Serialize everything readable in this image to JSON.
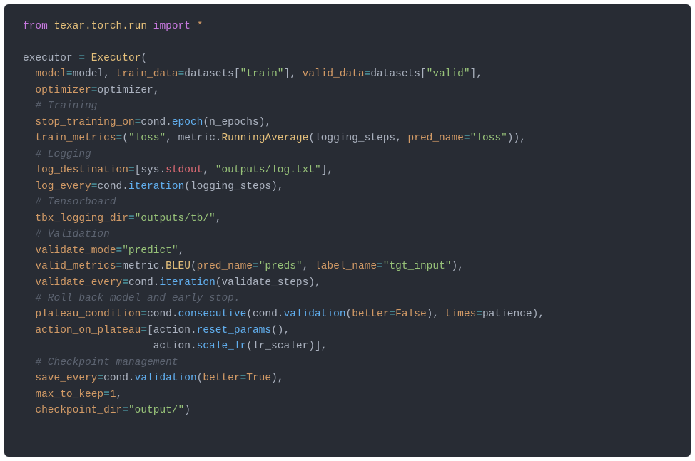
{
  "line1": {
    "from": "from",
    "mod": "texar.torch.run",
    "imp": "import",
    "star": "*"
  },
  "line3": {
    "lhs": "executor ",
    "eq": "= ",
    "cls": "Executor",
    "open": "("
  },
  "line4": {
    "i": "  ",
    "k1": "model",
    "eq": "=",
    "v1": "model, ",
    "k2": "train_data",
    "v2": "datasets[",
    "s2": "\"train\"",
    "c2": "], ",
    "k3": "valid_data",
    "v3": "datasets[",
    "s3": "\"valid\"",
    "c3": "],"
  },
  "line5": {
    "i": "  ",
    "k": "optimizer",
    "eq": "=",
    "v": "optimizer,"
  },
  "line6": {
    "i": "  ",
    "cmt": "# Training"
  },
  "line7": {
    "i": "  ",
    "k": "stop_training_on",
    "eq": "=",
    "obj": "cond.",
    "fn": "epoch",
    "open": "(",
    "arg": "n_epochs",
    "close": "),"
  },
  "line8": {
    "i": "  ",
    "k": "train_metrics",
    "eq": "=",
    "open": "(",
    "s": "\"loss\"",
    "comma": ", ",
    "obj": "metric.",
    "cls": "RunningAverage",
    "open2": "(",
    "arg1": "logging_steps, ",
    "k2": "pred_name",
    "eq2": "=",
    "s2": "\"loss\"",
    "close": ")),"
  },
  "line9": {
    "i": "  ",
    "cmt": "# Logging"
  },
  "line10": {
    "i": "  ",
    "k": "log_destination",
    "eq": "=",
    "open": "[",
    "obj": "sys.",
    "attr": "stdout",
    "comma": ", ",
    "s": "\"outputs/log.txt\"",
    "close": "],"
  },
  "line11": {
    "i": "  ",
    "k": "log_every",
    "eq": "=",
    "obj": "cond.",
    "fn": "iteration",
    "open": "(",
    "arg": "logging_steps",
    "close": "),"
  },
  "line12": {
    "i": "  ",
    "cmt": "# Tensorboard"
  },
  "line13": {
    "i": "  ",
    "k": "tbx_logging_dir",
    "eq": "=",
    "s": "\"outputs/tb/\"",
    "comma": ","
  },
  "line14": {
    "i": "  ",
    "cmt": "# Validation"
  },
  "line15": {
    "i": "  ",
    "k": "validate_mode",
    "eq": "=",
    "s": "\"predict\"",
    "comma": ","
  },
  "line16": {
    "i": "  ",
    "k": "valid_metrics",
    "eq": "=",
    "obj": "metric.",
    "cls": "BLEU",
    "open": "(",
    "k1": "pred_name",
    "eq1": "=",
    "s1": "\"preds\"",
    "comma": ", ",
    "k2": "label_name",
    "eq2": "=",
    "s2": "\"tgt_input\"",
    "close": "),"
  },
  "line17": {
    "i": "  ",
    "k": "validate_every",
    "eq": "=",
    "obj": "cond.",
    "fn": "iteration",
    "open": "(",
    "arg": "validate_steps",
    "close": "),"
  },
  "line18": {
    "i": "  ",
    "cmt": "# Roll back model and early stop."
  },
  "line19": {
    "i": "  ",
    "k": "plateau_condition",
    "eq": "=",
    "obj": "cond.",
    "fn": "consecutive",
    "open": "(",
    "obj2": "cond.",
    "fn2": "validation",
    "open2": "(",
    "k2": "better",
    "eq2": "=",
    "b": "False",
    "close2": "), ",
    "k3": "times",
    "eq3": "=",
    "arg": "patience",
    "close": "),"
  },
  "line20": {
    "i": "  ",
    "k": "action_on_plateau",
    "eq": "=",
    "open": "[",
    "obj": "action.",
    "fn": "reset_params",
    "paren": "(),"
  },
  "line21": {
    "i": "                     ",
    "obj": "action.",
    "fn": "scale_lr",
    "open": "(",
    "arg": "lr_scaler",
    "close": ")],"
  },
  "line22": {
    "i": "  ",
    "cmt": "# Checkpoint management"
  },
  "line23": {
    "i": "  ",
    "k": "save_every",
    "eq": "=",
    "obj": "cond.",
    "fn": "validation",
    "open": "(",
    "k2": "better",
    "eq2": "=",
    "b": "True",
    "close": "),"
  },
  "line24": {
    "i": "  ",
    "k": "max_to_keep",
    "eq": "=",
    "n": "1",
    "comma": ","
  },
  "line25": {
    "i": "  ",
    "k": "checkpoint_dir",
    "eq": "=",
    "s": "\"output/\"",
    "close": ")"
  }
}
